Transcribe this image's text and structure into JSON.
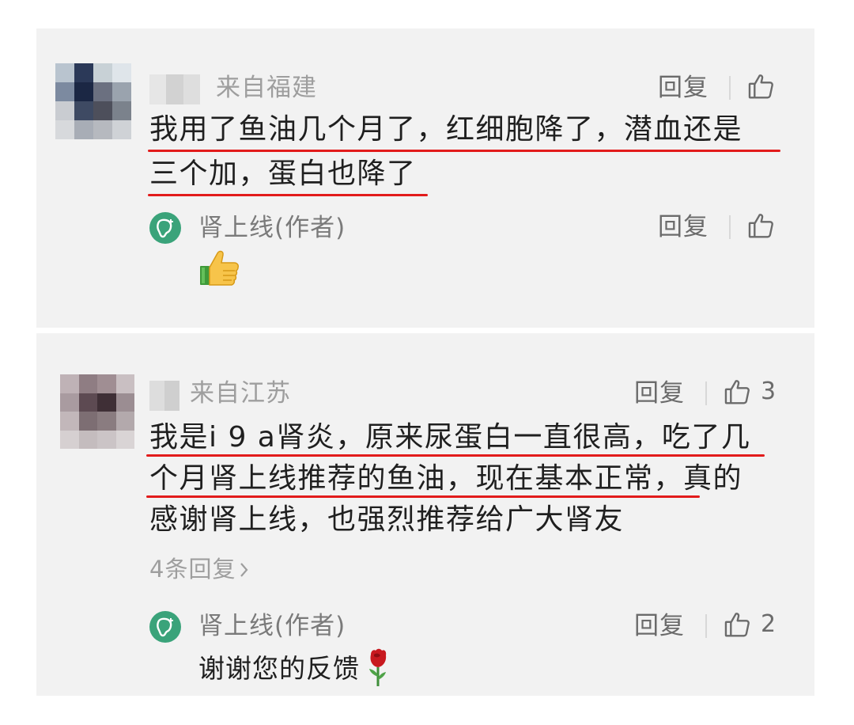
{
  "comments": [
    {
      "location": "来自福建",
      "reply_label": "回复",
      "text_line1": "我用了鱼油几个月了，红细胞降了，潜血还是",
      "text_line2": "三个加，蛋白也降了",
      "author_reply": {
        "author_name": "肾上线(作者)",
        "reply_label": "回复",
        "emoji": "thumbs-up-emoji"
      }
    },
    {
      "location": "来自江苏",
      "reply_label": "回复",
      "like_count": "3",
      "text_line1": "我是i 9 a肾炎，原来尿蛋白一直很高，吃了几",
      "text_line2": "个月肾上线推荐的鱼油，现在基本正常，真的",
      "text_line3": "感谢肾上线，也强烈推荐给广大肾友",
      "more_replies": "4条回复",
      "author_reply": {
        "author_name": "肾上线(作者)",
        "reply_label": "回复",
        "like_count": "2",
        "text": "谢谢您的反馈",
        "emoji": "rose-emoji"
      }
    }
  ],
  "colors": {
    "card_bg": "#f2f2f2",
    "highlight_underline": "#e21b1b",
    "author_logo": "#3aa37a",
    "meta_text": "#9e9e9e"
  }
}
